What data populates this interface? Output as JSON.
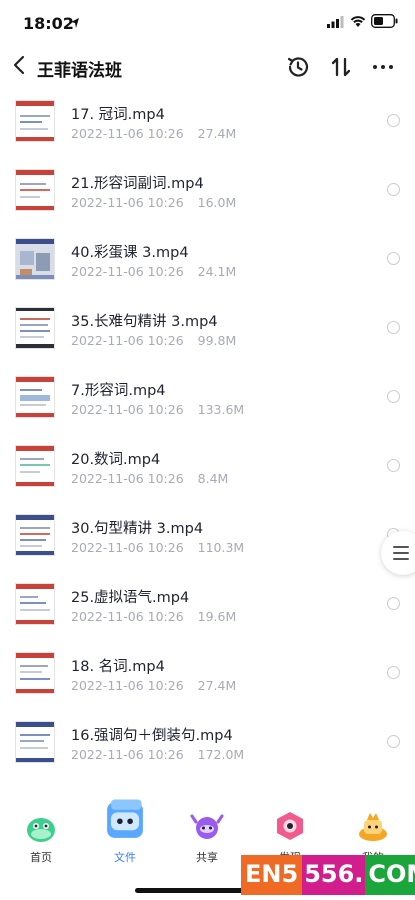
{
  "status": {
    "time": "18:02"
  },
  "header": {
    "title": "王菲语法班"
  },
  "files": [
    {
      "name": "17. 冠词.mp4",
      "date": "2022-11-06 10:26",
      "size": "27.4M",
      "thumb_top": "#c9423a",
      "thumb_bottom": "#c9423a"
    },
    {
      "name": "21.形容词副词.mp4",
      "date": "2022-11-06 10:26",
      "size": "16.0M",
      "thumb_top": "#c9423a",
      "thumb_bottom": "#c9423a"
    },
    {
      "name": "40.彩蛋课 3.mp4",
      "date": "2022-11-06 10:26",
      "size": "24.1M",
      "thumb_top": "#3b4f8c",
      "thumb_bottom": "#7b8fb8"
    },
    {
      "name": "35.长难句精讲 3.mp4",
      "date": "2022-11-06 10:26",
      "size": "99.8M",
      "thumb_top": "#2d2f36",
      "thumb_bottom": "#2d2f36"
    },
    {
      "name": "7.形容词.mp4",
      "date": "2022-11-06 10:26",
      "size": "133.6M",
      "thumb_top": "#c9423a",
      "thumb_bottom": "#c9423a"
    },
    {
      "name": "20.数词.mp4",
      "date": "2022-11-06 10:26",
      "size": "8.4M",
      "thumb_top": "#c9423a",
      "thumb_bottom": "#c9423a"
    },
    {
      "name": "30.句型精讲 3.mp4",
      "date": "2022-11-06 10:26",
      "size": "110.3M",
      "thumb_top": "#3b4f8c",
      "thumb_bottom": "#3b4f8c"
    },
    {
      "name": "25.虚拟语气.mp4",
      "date": "2022-11-06 10:26",
      "size": "19.6M",
      "thumb_top": "#c9423a",
      "thumb_bottom": "#c9423a"
    },
    {
      "name": "18. 名词.mp4",
      "date": "2022-11-06 10:26",
      "size": "27.4M",
      "thumb_top": "#c9423a",
      "thumb_bottom": "#c9423a"
    },
    {
      "name": "16.强调句＋倒装句.mp4",
      "date": "2022-11-06 10:26",
      "size": "172.0M",
      "thumb_top": "#3b4f8c",
      "thumb_bottom": "#3b4f8c"
    }
  ],
  "nav": {
    "items": [
      {
        "label": "首页",
        "icon": "home-mascot-icon",
        "color": "#3ecf8e"
      },
      {
        "label": "文件",
        "icon": "file-mascot-icon",
        "color": "#5aa7ff",
        "active": true
      },
      {
        "label": "共享",
        "icon": "share-mascot-icon",
        "color": "#9a5cf0"
      },
      {
        "label": "发现",
        "icon": "discover-mascot-icon",
        "color": "#f05a8c"
      },
      {
        "label": "我的",
        "icon": "profile-mascot-icon",
        "color": "#f5a623"
      }
    ],
    "active_color": "#3a7bff"
  },
  "watermark": {
    "part1": "EN5",
    "part2": "556.",
    "part3": "COM"
  }
}
